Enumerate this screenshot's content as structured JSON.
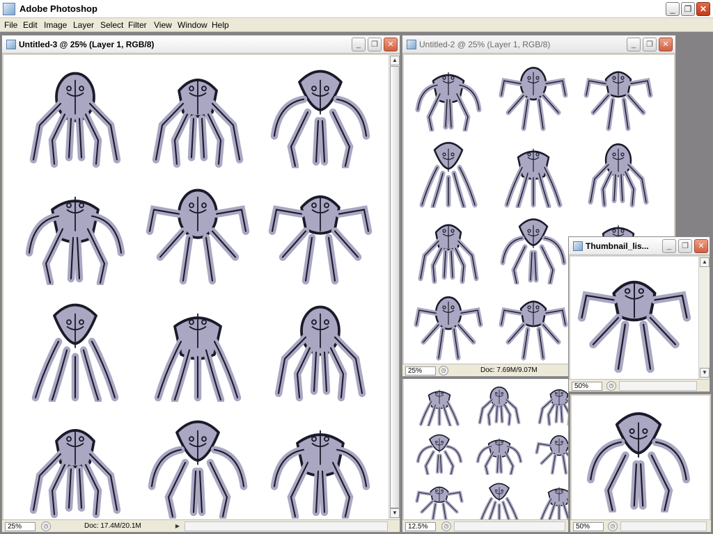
{
  "app": {
    "title": "Adobe Photoshop"
  },
  "window_controls": {
    "minimize": "_",
    "restore": "❐",
    "close": "✕"
  },
  "menu": [
    "File",
    "Edit",
    "Image",
    "Layer",
    "Select",
    "Filter",
    "View",
    "Window",
    "Help"
  ],
  "doc1": {
    "title": "Untitled-3 @ 25% (Layer 1, RGB/8)",
    "zoom": "25%",
    "info": "Doc: 17.4M/20.1M"
  },
  "doc2": {
    "title": "Untitled-2 @ 25% (Layer 1, RGB/8)",
    "zoom": "25%",
    "info": "Doc: 7.69M/9.07M"
  },
  "doc3": {
    "zoom": "12.5%"
  },
  "thumb": {
    "title": "Thumbnail_lis...",
    "zoom": "50%"
  },
  "thumb2": {
    "zoom": "50%"
  },
  "icons": {
    "scroll_up": "▲",
    "scroll_down": "▼",
    "scroll_left": "◀",
    "scroll_right": "▶",
    "status_arrow": "▶"
  },
  "colors": {
    "creature_fill": "#a9a7c2",
    "creature_stroke": "#1a1a2a",
    "canvas": "#ffffff",
    "workspace": "#848284"
  }
}
